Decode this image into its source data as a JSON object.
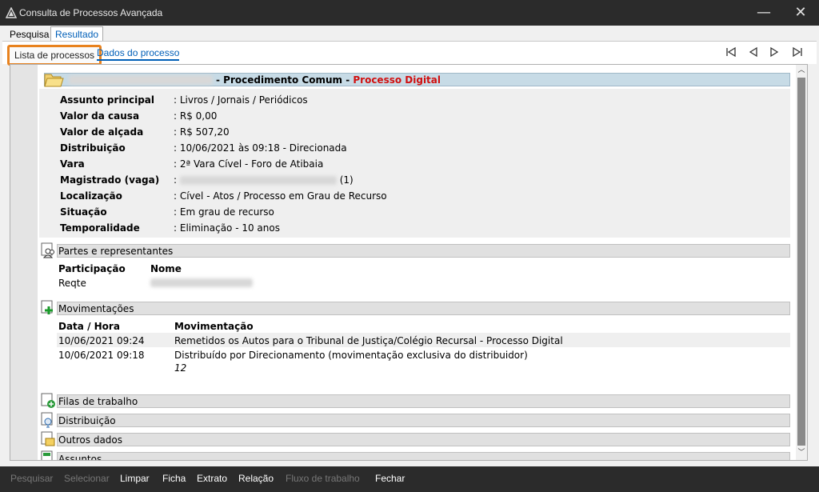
{
  "window": {
    "title": "Consulta de Processos Avançada",
    "minimize": "—",
    "close": "✕"
  },
  "main_tabs": [
    {
      "label": "Pesquisa"
    },
    {
      "label": "Resultado"
    }
  ],
  "sub_tabs": [
    {
      "label": "Lista de processos"
    },
    {
      "label": "Dados do processo"
    }
  ],
  "nav": {
    "first": "|◁",
    "prev": "◁",
    "next": "▷",
    "last": "▷|"
  },
  "process": {
    "header_sep": "- Procedimento Comum - ",
    "digital": "Processo Digital",
    "details": [
      {
        "label": "Assunto principal",
        "value": ": Livros / Jornais / Periódicos"
      },
      {
        "label": "Valor da causa",
        "value": ": R$ 0,00"
      },
      {
        "label": "Valor de alçada",
        "value": ": R$ 507,20"
      },
      {
        "label": "Distribuição",
        "value": ": 10/06/2021 às 09:18 - Direcionada"
      },
      {
        "label": "Vara",
        "value": ": 2ª Vara Cível - Foro de Atibaia"
      },
      {
        "label": "Magistrado (vaga)",
        "value": ":",
        "suffix": "(1)"
      },
      {
        "label": "Localização",
        "value": ": Cível - Atos / Processo em Grau de Recurso"
      },
      {
        "label": "Situação",
        "value": ": Em grau de recurso"
      },
      {
        "label": "Temporalidade",
        "value": ": Eliminação - 10 anos"
      }
    ]
  },
  "partes": {
    "title": "Partes e representantes",
    "col_participacao": "Participação",
    "col_nome": "Nome",
    "rows": [
      {
        "participacao": "Reqte"
      }
    ]
  },
  "movimentacoes": {
    "title": "Movimentações",
    "col_data": "Data / Hora",
    "col_mov": "Movimentação",
    "rows": [
      {
        "data": "10/06/2021 09:24",
        "mov": "Remetidos os Autos para o Tribunal de Justiça/Colégio Recursal - Processo Digital",
        "extra": ""
      },
      {
        "data": "10/06/2021 09:18",
        "mov": "Distribuído por Direcionamento (movimentação exclusiva do distribuidor)",
        "extra": "12"
      }
    ]
  },
  "sections": [
    {
      "title": "Filas de trabalho"
    },
    {
      "title": "Distribuição"
    },
    {
      "title": "Outros dados"
    },
    {
      "title": "Assuntos"
    }
  ],
  "bottom_bar": [
    {
      "label": "Pesquisar",
      "enabled": false
    },
    {
      "label": "Selecionar",
      "enabled": false
    },
    {
      "label": "Limpar",
      "enabled": true
    },
    {
      "label": "Ficha",
      "enabled": true
    },
    {
      "label": "Extrato",
      "enabled": true
    },
    {
      "label": "Relação",
      "enabled": true
    },
    {
      "label": "Fluxo de trabalho",
      "enabled": false
    },
    {
      "label": "Fechar",
      "enabled": true
    }
  ],
  "colors": {
    "highlight": "#e8821e",
    "link": "#005fb8",
    "digital": "#d01010",
    "header_bg": "#c7dbe6"
  }
}
